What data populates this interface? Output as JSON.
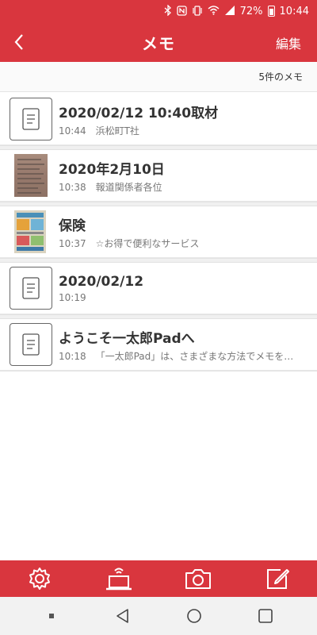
{
  "status_bar": {
    "battery_percent": "72%",
    "time": "10:44"
  },
  "app_bar": {
    "title": "メモ",
    "edit_label": "編集"
  },
  "list_header": {
    "count_text": "5件のメモ"
  },
  "memos": [
    {
      "title": "2020/02/12 10:40取材",
      "time": "10:44",
      "preview": "浜松町T社",
      "thumbnail": "document-icon"
    },
    {
      "title": "2020年2月10日",
      "time": "10:38",
      "preview": "報道関係者各位",
      "thumbnail": "photo-document"
    },
    {
      "title": "保険",
      "time": "10:37",
      "preview": "☆お得で便利なサービス",
      "thumbnail": "photo-flyer"
    },
    {
      "title": "2020/02/12",
      "time": "10:19",
      "preview": "",
      "thumbnail": "document-icon"
    },
    {
      "title": "ようこそ一太郎Padへ",
      "time": "10:18",
      "preview": "「一太郎Pad」は、さまざまな方法でメモを作成できます。",
      "thumbnail": "document-icon"
    }
  ],
  "toolbar": {
    "icons": [
      "settings-icon",
      "laptop-transfer-icon",
      "camera-icon",
      "new-memo-icon"
    ]
  },
  "colors": {
    "brand_red": "#d9363e"
  }
}
